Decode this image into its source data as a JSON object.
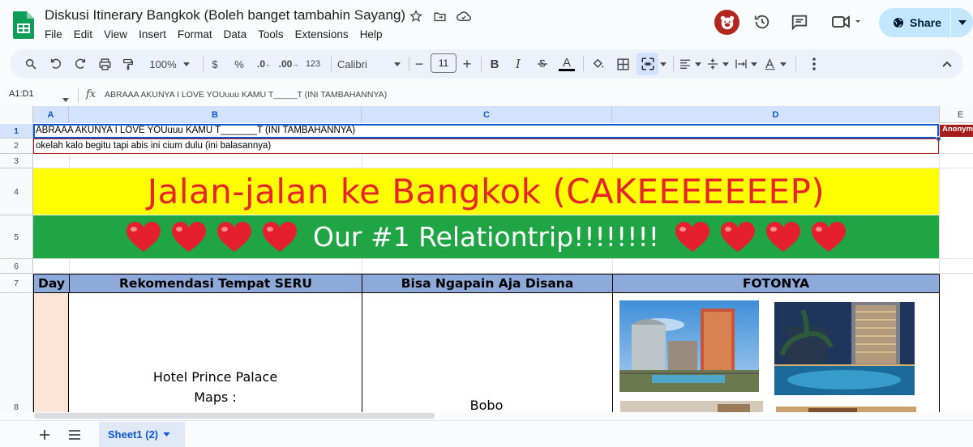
{
  "app": {
    "title": "Diskusi Itinerary Bangkok (Boleh banget tambahin Sayang)",
    "menu": [
      "File",
      "Edit",
      "View",
      "Insert",
      "Format",
      "Data",
      "Tools",
      "Extensions",
      "Help"
    ],
    "share_label": "Share"
  },
  "toolbar": {
    "zoom": "100%",
    "currency": "$",
    "percent": "%",
    "decrease_decimals": ".0",
    "increase_decimals": ".00",
    "number_format": "123",
    "font": "Calibri",
    "font_size": "11",
    "minus": "−",
    "plus": "+",
    "bold": "B",
    "italic": "I",
    "text_color_letter": "A",
    "text_color": "#000000"
  },
  "formula_bar": {
    "name_box": "A1:D1",
    "fx": "fx",
    "content": "ABRAAA AKUNYA I LOVE YOUuuu KAMU T_____T (INI TAMBAHANNYA)"
  },
  "columns": [
    "A",
    "B",
    "C",
    "D",
    "E"
  ],
  "rows": [
    "1",
    "2",
    "3",
    "4",
    "5",
    "6",
    "7",
    "8"
  ],
  "cells": {
    "r1": "ABRAAA AKUNYA I LOVE YOUuuu KAMU T_______T (INI TAMBAHANNYA)",
    "r2": "okelah kalo begitu tapi abis ini cium dulu (ini balasannya)",
    "anon_tag": "Anonym",
    "banner_title": "Jalan-jalan ke Bangkok (CAKEEEEEEEP)",
    "banner_subtitle": "Our #1 Relationtrip!!!!!!!!",
    "headers": {
      "day": "Day",
      "place": "Rekomendasi Tempat SERU",
      "activity": "Bisa Ngapain Aja Disana",
      "photo": "FOTONYA"
    },
    "row8": {
      "place_line1": "Hotel Prince Palace",
      "place_line2": "Maps :",
      "activity": "Bobo"
    }
  },
  "colors": {
    "banner_yellow": "#ffff00",
    "banner_red_text": "#e8242b",
    "banner_green": "#1fa544",
    "header_blue": "#8eaadb",
    "day_peach": "#fce5d6",
    "selection_blue": "#0b57d0",
    "collaborator_red": "#a61c1c"
  },
  "sheets": [
    {
      "label": "Sheet1 (2)",
      "active": true
    }
  ]
}
